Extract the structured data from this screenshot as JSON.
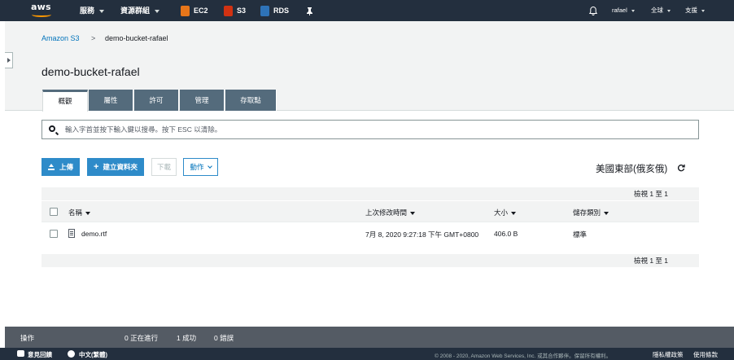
{
  "topnav": {
    "logo_text": "aws",
    "services": "服務",
    "resource_groups": "資源群組",
    "ec2": "EC2",
    "s3": "S3",
    "rds": "RDS",
    "user": "rafael",
    "region": "全球",
    "support": "支援"
  },
  "breadcrumb": {
    "root": "Amazon S3",
    "separator": ">",
    "current": "demo-bucket-rafael"
  },
  "bucket_title": "demo-bucket-rafael",
  "tabs": [
    {
      "label": "概觀",
      "active": true
    },
    {
      "label": "屬性",
      "active": false
    },
    {
      "label": "許可",
      "active": false
    },
    {
      "label": "管理",
      "active": false
    },
    {
      "label": "存取點",
      "active": false
    }
  ],
  "search": {
    "placeholder": "輸入字首並按下輸入鍵以搜尋。按下 ESC 以清除。",
    "value": ""
  },
  "toolbar": {
    "upload": "上傳",
    "create_folder": "建立資料夾",
    "download": "下載",
    "actions": "動作",
    "region": "美國東部(俄亥俄)"
  },
  "view_range": "檢視 1 至 1",
  "table": {
    "columns": [
      "名稱",
      "上次修改時間",
      "大小",
      "儲存類別"
    ],
    "rows": [
      {
        "name": "demo.rtf",
        "modified": "7月 8, 2020 9:27:18 下午 GMT+0800",
        "size": "406.0 B",
        "storage_class": "標準"
      }
    ]
  },
  "operations": {
    "label": "操作",
    "in_progress": "0 正在進行",
    "success": "1 成功",
    "errors": "0 錯誤"
  },
  "footer": {
    "feedback": "意見回饋",
    "language": "中文(繁體)",
    "copyright": "© 2008 - 2020, Amazon Web Services, Inc. 或其合作夥伴。保留所有權利。",
    "privacy": "隱私權政策",
    "terms": "使用條款"
  },
  "colors": {
    "nav_bg": "#232f3e",
    "tab_bg": "#546b7c",
    "primary_button": "#2e8bc9",
    "link": "#0073bb",
    "ops_bar": "#545b64"
  }
}
